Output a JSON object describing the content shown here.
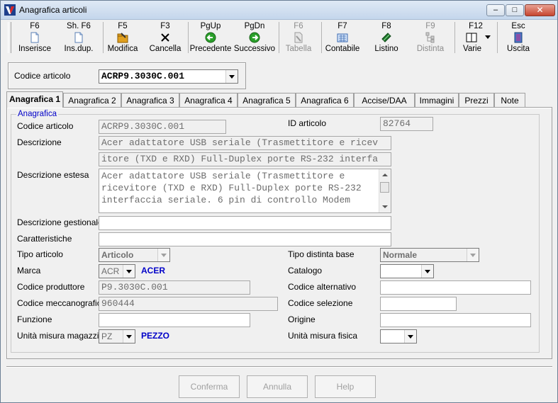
{
  "window": {
    "title": "Anagrafica articoli",
    "minimize_glyph": "–",
    "maximize_glyph": "□",
    "close_glyph": "✕"
  },
  "toolbar": [
    {
      "key": "F6",
      "label": "Inserisce",
      "icon": "new-document-icon",
      "enabled": true
    },
    {
      "key": "Sh. F6",
      "label": "Ins.dup.",
      "icon": "duplicate-document-icon",
      "enabled": true
    },
    {
      "key": "F5",
      "label": "Modifica",
      "icon": "edit-folder-icon",
      "enabled": true
    },
    {
      "key": "F3",
      "label": "Cancella",
      "icon": "delete-x-icon",
      "enabled": true
    },
    {
      "key": "PgUp",
      "label": "Precedente",
      "icon": "previous-arrow-icon",
      "enabled": true
    },
    {
      "key": "PgDn",
      "label": "Successivo",
      "icon": "next-arrow-icon",
      "enabled": true
    },
    {
      "key": "F6",
      "label": "Tabella",
      "icon": "table-icon",
      "enabled": false
    },
    {
      "key": "F7",
      "label": "Contabile",
      "icon": "calculator-icon",
      "enabled": true
    },
    {
      "key": "F8",
      "label": "Listino",
      "icon": "money-icon",
      "enabled": true
    },
    {
      "key": "F9",
      "label": "Distinta",
      "icon": "tree-structure-icon",
      "enabled": false
    },
    {
      "key": "F12",
      "label": "Varie",
      "icon": "window-dropdown-icon",
      "enabled": true
    },
    {
      "key": "Esc",
      "label": "Uscita",
      "icon": "exit-door-icon",
      "enabled": true
    }
  ],
  "selector": {
    "label": "Codice articolo",
    "value": "ACRP9.3030C.001"
  },
  "tabs": [
    {
      "label": "Anagrafica 1",
      "active": true
    },
    {
      "label": "Anagrafica 2",
      "active": false
    },
    {
      "label": "Anagrafica 3",
      "active": false
    },
    {
      "label": "Anagrafica 4",
      "active": false
    },
    {
      "label": "Anagrafica 5",
      "active": false
    },
    {
      "label": "Anagrafica 6",
      "active": false
    },
    {
      "label": "Accise/DAA",
      "active": false
    },
    {
      "label": "Immagini",
      "active": false
    },
    {
      "label": "Prezzi",
      "active": false
    },
    {
      "label": "Note",
      "active": false
    }
  ],
  "form": {
    "group_label": "Anagrafica",
    "codice_articolo": {
      "label": "Codice articolo",
      "value": "ACRP9.3030C.001"
    },
    "id_articolo": {
      "label": "ID articolo",
      "value": "82764"
    },
    "descrizione": {
      "label": "Descrizione",
      "line1": "Acer adattatore USB seriale (Trasmettitore e ricev",
      "line2": "itore (TXD e RXD) Full-Duplex porte RS-232 interfa"
    },
    "descrizione_estesa": {
      "label": "Descrizione estesa",
      "line1": "Acer adattatore USB seriale (Trasmettitore e",
      "line2": "ricevitore (TXD e RXD) Full-Duplex porte RS-232",
      "line3": "interfaccia seriale. 6 pin di controllo Modem"
    },
    "descrizione_gestionale": {
      "label": "Descrizione gestionale",
      "value": ""
    },
    "caratteristiche": {
      "label": "Caratteristiche",
      "value": ""
    },
    "tipo_articolo": {
      "label": "Tipo articolo",
      "value": "Articolo"
    },
    "tipo_distinta_base": {
      "label": "Tipo distinta base",
      "value": "Normale"
    },
    "marca": {
      "label": "Marca",
      "value": "ACR",
      "description": "ACER"
    },
    "catalogo": {
      "label": "Catalogo",
      "value": ""
    },
    "codice_produttore": {
      "label": "Codice produttore",
      "value": "P9.3030C.001"
    },
    "codice_alternativo": {
      "label": "Codice alternativo",
      "value": ""
    },
    "codice_meccanografico": {
      "label": "Codice meccanografico",
      "value": "960444"
    },
    "codice_selezione": {
      "label": "Codice selezione",
      "value": ""
    },
    "funzione": {
      "label": "Funzione",
      "value": ""
    },
    "origine": {
      "label": "Origine",
      "value": ""
    },
    "unita_misura_magazzino": {
      "label": "Unità misura magazzino",
      "value": "PZ",
      "description": "PEZZO"
    },
    "unita_misura_fisica": {
      "label": "Unità misura fisica",
      "value": ""
    }
  },
  "buttons": {
    "conferma": "Conferma",
    "annulla": "Annulla",
    "help": "Help"
  },
  "colors": {
    "accent_blue": "#0000c8",
    "disabled_text": "#8c8c8c"
  }
}
